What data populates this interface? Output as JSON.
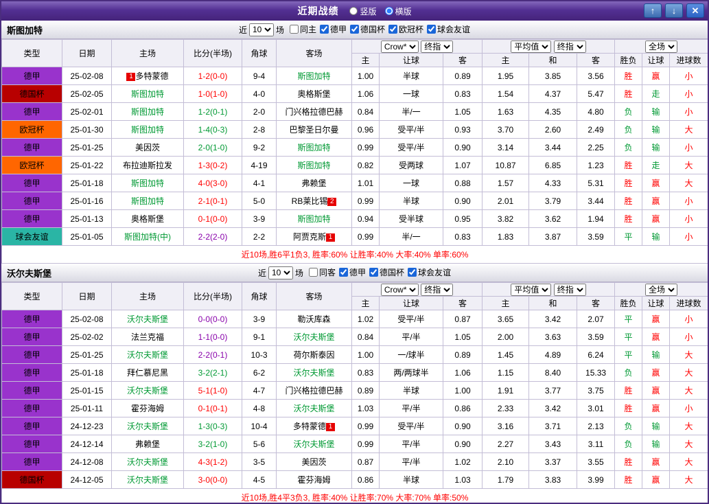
{
  "colors": {
    "score_win": "#ff0000",
    "score_draw": "#8800aa",
    "score_loss": "#009933",
    "focal_team": "#009933",
    "opponent_team": "#000000",
    "outcome_red": "#ff0000",
    "outcome_green": "#009933",
    "summary_text": "#ff0000",
    "badge_bg": "#e60000",
    "league_colors": {
      "德甲": "#9933cc",
      "德国杯": "#b80000",
      "欧冠杯": "#ff6600",
      "球会友谊": "#2ab5a5"
    }
  },
  "outcome_color_map": {
    "胜": "red",
    "平": "green",
    "负": "green",
    "赢": "red",
    "走": "green",
    "输": "green",
    "大": "red",
    "小": "red"
  },
  "title_bar": {
    "title": "近期战绩",
    "view_modes": [
      {
        "label": "竖版",
        "selected": false
      },
      {
        "label": "横版",
        "selected": true
      }
    ],
    "buttons": {
      "up": "↑",
      "down": "↓",
      "close": "✕"
    }
  },
  "table_header": {
    "static": [
      "类型",
      "日期",
      "主场",
      "比分(半场)",
      "角球",
      "客场"
    ],
    "odds_company": "Crow*",
    "odds_index": "终指",
    "avg_label": "平均值",
    "avg_index": "终指",
    "fulltime_label": "全场",
    "sub": [
      "主",
      "让球",
      "客",
      "主",
      "和",
      "客",
      "胜负",
      "让球",
      "进球数"
    ]
  },
  "sections": [
    {
      "team": "斯图加特",
      "filters": {
        "near_label": "近",
        "count": "10",
        "games_label": "场",
        "checkboxes": [
          {
            "label": "同主",
            "checked": false
          },
          {
            "label": "德甲",
            "checked": true
          },
          {
            "label": "德国杯",
            "checked": true
          },
          {
            "label": "欧冠杯",
            "checked": true
          },
          {
            "label": "球会友谊",
            "checked": true
          }
        ]
      },
      "rows": [
        {
          "league": "德甲",
          "date": "25-02-08",
          "home": {
            "name": "多特蒙德",
            "focal": false,
            "badge": "1",
            "badge_pos": "before"
          },
          "score": "1-2(0-0)",
          "result": "win",
          "corners": "9-4",
          "away": {
            "name": "斯图加特",
            "focal": true
          },
          "odds": [
            "1.00",
            "半球",
            "0.89"
          ],
          "avg": [
            "1.95",
            "3.85",
            "3.56"
          ],
          "outcome": [
            "胜",
            "赢",
            "小"
          ]
        },
        {
          "league": "德国杯",
          "date": "25-02-05",
          "home": {
            "name": "斯图加特",
            "focal": true
          },
          "score": "1-0(1-0)",
          "result": "win",
          "corners": "4-0",
          "away": {
            "name": "奥格斯堡",
            "focal": false
          },
          "odds": [
            "1.06",
            "一球",
            "0.83"
          ],
          "avg": [
            "1.54",
            "4.37",
            "5.47"
          ],
          "outcome": [
            "胜",
            "走",
            "小"
          ]
        },
        {
          "league": "德甲",
          "date": "25-02-01",
          "home": {
            "name": "斯图加特",
            "focal": true
          },
          "score": "1-2(0-1)",
          "result": "loss",
          "corners": "2-0",
          "away": {
            "name": "门兴格拉德巴赫",
            "focal": false
          },
          "odds": [
            "0.84",
            "半/一",
            "1.05"
          ],
          "avg": [
            "1.63",
            "4.35",
            "4.80"
          ],
          "outcome": [
            "负",
            "输",
            "小"
          ]
        },
        {
          "league": "欧冠杯",
          "date": "25-01-30",
          "home": {
            "name": "斯图加特",
            "focal": true
          },
          "score": "1-4(0-3)",
          "result": "loss",
          "corners": "2-8",
          "away": {
            "name": "巴黎圣日尔曼",
            "focal": false
          },
          "odds": [
            "0.96",
            "受平/半",
            "0.93"
          ],
          "avg": [
            "3.70",
            "2.60",
            "2.49"
          ],
          "outcome": [
            "负",
            "输",
            "大"
          ]
        },
        {
          "league": "德甲",
          "date": "25-01-25",
          "home": {
            "name": "美因茨",
            "focal": false
          },
          "score": "2-0(1-0)",
          "result": "loss",
          "corners": "9-2",
          "away": {
            "name": "斯图加特",
            "focal": true
          },
          "odds": [
            "0.99",
            "受平/半",
            "0.90"
          ],
          "avg": [
            "3.14",
            "3.44",
            "2.25"
          ],
          "outcome": [
            "负",
            "输",
            "小"
          ]
        },
        {
          "league": "欧冠杯",
          "date": "25-01-22",
          "home": {
            "name": "布拉迪斯拉发",
            "focal": false
          },
          "score": "1-3(0-2)",
          "result": "win",
          "corners": "4-19",
          "away": {
            "name": "斯图加特",
            "focal": true
          },
          "odds": [
            "0.82",
            "受两球",
            "1.07"
          ],
          "avg": [
            "10.87",
            "6.85",
            "1.23"
          ],
          "outcome": [
            "胜",
            "走",
            "大"
          ]
        },
        {
          "league": "德甲",
          "date": "25-01-18",
          "home": {
            "name": "斯图加特",
            "focal": true
          },
          "score": "4-0(3-0)",
          "result": "win",
          "corners": "4-1",
          "away": {
            "name": "弗赖堡",
            "focal": false
          },
          "odds": [
            "1.01",
            "一球",
            "0.88"
          ],
          "avg": [
            "1.57",
            "4.33",
            "5.31"
          ],
          "outcome": [
            "胜",
            "赢",
            "大"
          ]
        },
        {
          "league": "德甲",
          "date": "25-01-16",
          "home": {
            "name": "斯图加特",
            "focal": true
          },
          "score": "2-1(0-1)",
          "result": "win",
          "corners": "5-0",
          "away": {
            "name": "RB莱比锡",
            "focal": false,
            "badge": "2",
            "badge_pos": "after"
          },
          "odds": [
            "0.99",
            "半球",
            "0.90"
          ],
          "avg": [
            "2.01",
            "3.79",
            "3.44"
          ],
          "outcome": [
            "胜",
            "赢",
            "小"
          ]
        },
        {
          "league": "德甲",
          "date": "25-01-13",
          "home": {
            "name": "奥格斯堡",
            "focal": false
          },
          "score": "0-1(0-0)",
          "result": "win",
          "corners": "3-9",
          "away": {
            "name": "斯图加特",
            "focal": true
          },
          "odds": [
            "0.94",
            "受半球",
            "0.95"
          ],
          "avg": [
            "3.82",
            "3.62",
            "1.94"
          ],
          "outcome": [
            "胜",
            "赢",
            "小"
          ]
        },
        {
          "league": "球会友谊",
          "date": "25-01-05",
          "home": {
            "name": "斯图加特(中)",
            "focal": true
          },
          "score": "2-2(2-0)",
          "result": "draw",
          "corners": "2-2",
          "away": {
            "name": "阿贾克斯",
            "focal": false,
            "badge": "1",
            "badge_pos": "after"
          },
          "odds": [
            "0.99",
            "半/一",
            "0.83"
          ],
          "avg": [
            "1.83",
            "3.87",
            "3.59"
          ],
          "outcome": [
            "平",
            "输",
            "小"
          ]
        }
      ],
      "summary": "近10场,胜6平1负3, 胜率:60% 让胜率:40% 大率:40% 单率:60%"
    },
    {
      "team": "沃尔夫斯堡",
      "filters": {
        "near_label": "近",
        "count": "10",
        "games_label": "场",
        "checkboxes": [
          {
            "label": "同客",
            "checked": false
          },
          {
            "label": "德甲",
            "checked": true
          },
          {
            "label": "德国杯",
            "checked": true
          },
          {
            "label": "球会友谊",
            "checked": true
          }
        ]
      },
      "rows": [
        {
          "league": "德甲",
          "date": "25-02-08",
          "home": {
            "name": "沃尔夫斯堡",
            "focal": true
          },
          "score": "0-0(0-0)",
          "result": "draw",
          "corners": "3-9",
          "away": {
            "name": "勒沃库森",
            "focal": false
          },
          "odds": [
            "1.02",
            "受平/半",
            "0.87"
          ],
          "avg": [
            "3.65",
            "3.42",
            "2.07"
          ],
          "outcome": [
            "平",
            "赢",
            "小"
          ]
        },
        {
          "league": "德甲",
          "date": "25-02-02",
          "home": {
            "name": "法兰克福",
            "focal": false
          },
          "score": "1-1(0-0)",
          "result": "draw",
          "corners": "9-1",
          "away": {
            "name": "沃尔夫斯堡",
            "focal": true
          },
          "odds": [
            "0.84",
            "平/半",
            "1.05"
          ],
          "avg": [
            "2.00",
            "3.63",
            "3.59"
          ],
          "outcome": [
            "平",
            "赢",
            "小"
          ]
        },
        {
          "league": "德甲",
          "date": "25-01-25",
          "home": {
            "name": "沃尔夫斯堡",
            "focal": true
          },
          "score": "2-2(0-1)",
          "result": "draw",
          "corners": "10-3",
          "away": {
            "name": "荷尔斯泰因",
            "focal": false
          },
          "odds": [
            "1.00",
            "一/球半",
            "0.89"
          ],
          "avg": [
            "1.45",
            "4.89",
            "6.24"
          ],
          "outcome": [
            "平",
            "输",
            "大"
          ]
        },
        {
          "league": "德甲",
          "date": "25-01-18",
          "home": {
            "name": "拜仁慕尼黑",
            "focal": false
          },
          "score": "3-2(2-1)",
          "result": "loss",
          "corners": "6-2",
          "away": {
            "name": "沃尔夫斯堡",
            "focal": true
          },
          "odds": [
            "0.83",
            "两/两球半",
            "1.06"
          ],
          "avg": [
            "1.15",
            "8.40",
            "15.33"
          ],
          "outcome": [
            "负",
            "赢",
            "大"
          ]
        },
        {
          "league": "德甲",
          "date": "25-01-15",
          "home": {
            "name": "沃尔夫斯堡",
            "focal": true
          },
          "score": "5-1(1-0)",
          "result": "win",
          "corners": "4-7",
          "away": {
            "name": "门兴格拉德巴赫",
            "focal": false
          },
          "odds": [
            "0.89",
            "半球",
            "1.00"
          ],
          "avg": [
            "1.91",
            "3.77",
            "3.75"
          ],
          "outcome": [
            "胜",
            "赢",
            "大"
          ]
        },
        {
          "league": "德甲",
          "date": "25-01-11",
          "home": {
            "name": "霍芬海姆",
            "focal": false
          },
          "score": "0-1(0-1)",
          "result": "win",
          "corners": "4-8",
          "away": {
            "name": "沃尔夫斯堡",
            "focal": true
          },
          "odds": [
            "1.03",
            "平/半",
            "0.86"
          ],
          "avg": [
            "2.33",
            "3.42",
            "3.01"
          ],
          "outcome": [
            "胜",
            "赢",
            "小"
          ]
        },
        {
          "league": "德甲",
          "date": "24-12-23",
          "home": {
            "name": "沃尔夫斯堡",
            "focal": true
          },
          "score": "1-3(0-3)",
          "result": "loss",
          "corners": "10-4",
          "away": {
            "name": "多特蒙德",
            "focal": false,
            "badge": "1",
            "badge_pos": "after"
          },
          "odds": [
            "0.99",
            "受平/半",
            "0.90"
          ],
          "avg": [
            "3.16",
            "3.71",
            "2.13"
          ],
          "outcome": [
            "负",
            "输",
            "大"
          ]
        },
        {
          "league": "德甲",
          "date": "24-12-14",
          "home": {
            "name": "弗赖堡",
            "focal": false
          },
          "score": "3-2(1-0)",
          "result": "loss",
          "corners": "5-6",
          "away": {
            "name": "沃尔夫斯堡",
            "focal": true
          },
          "odds": [
            "0.99",
            "平/半",
            "0.90"
          ],
          "avg": [
            "2.27",
            "3.43",
            "3.11"
          ],
          "outcome": [
            "负",
            "输",
            "大"
          ]
        },
        {
          "league": "德甲",
          "date": "24-12-08",
          "home": {
            "name": "沃尔夫斯堡",
            "focal": true
          },
          "score": "4-3(1-2)",
          "result": "win",
          "corners": "3-5",
          "away": {
            "name": "美因茨",
            "focal": false
          },
          "odds": [
            "0.87",
            "平/半",
            "1.02"
          ],
          "avg": [
            "2.10",
            "3.37",
            "3.55"
          ],
          "outcome": [
            "胜",
            "赢",
            "大"
          ]
        },
        {
          "league": "德国杯",
          "date": "24-12-05",
          "home": {
            "name": "沃尔夫斯堡",
            "focal": true
          },
          "score": "3-0(0-0)",
          "result": "win",
          "corners": "4-5",
          "away": {
            "name": "霍芬海姆",
            "focal": false
          },
          "odds": [
            "0.86",
            "半球",
            "1.03"
          ],
          "avg": [
            "1.79",
            "3.83",
            "3.99"
          ],
          "outcome": [
            "胜",
            "赢",
            "大"
          ]
        }
      ],
      "summary": "近10场,胜4平3负3, 胜率:40% 让胜率:70% 大率:70% 单率:50%"
    }
  ]
}
